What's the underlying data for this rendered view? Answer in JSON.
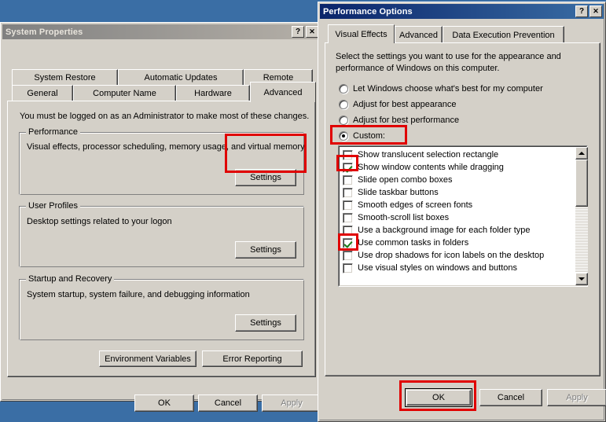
{
  "desktop": {
    "background_color": "#3a6ea5"
  },
  "system_properties": {
    "title": "System Properties",
    "titlebar_buttons": {
      "help": "?",
      "close": "✕"
    },
    "tabs_row1": [
      {
        "label": "System Restore",
        "active": false
      },
      {
        "label": "Automatic Updates",
        "active": false
      },
      {
        "label": "Remote",
        "active": false
      }
    ],
    "tabs_row2": [
      {
        "label": "General",
        "active": false
      },
      {
        "label": "Computer Name",
        "active": false
      },
      {
        "label": "Hardware",
        "active": false
      },
      {
        "label": "Advanced",
        "active": true
      }
    ],
    "notice": "You must be logged on as an Administrator to make most of these changes.",
    "groups": [
      {
        "title": "Performance",
        "description": "Visual effects, processor scheduling, memory usage, and virtual memory",
        "button": "Settings"
      },
      {
        "title": "User Profiles",
        "description": "Desktop settings related to your logon",
        "button": "Settings"
      },
      {
        "title": "Startup and Recovery",
        "description": "System startup, system failure, and debugging information",
        "button": "Settings"
      }
    ],
    "extra_buttons": [
      {
        "label": "Environment Variables"
      },
      {
        "label": "Error Reporting"
      }
    ],
    "footer_buttons": [
      {
        "label": "OK",
        "disabled": false
      },
      {
        "label": "Cancel",
        "disabled": false
      },
      {
        "label": "Apply",
        "disabled": true
      }
    ]
  },
  "performance_options": {
    "title": "Performance Options",
    "titlebar_buttons": {
      "help": "?",
      "close": "✕"
    },
    "tabs": [
      {
        "label": "Visual Effects",
        "active": true
      },
      {
        "label": "Advanced",
        "active": false
      },
      {
        "label": "Data Execution Prevention",
        "active": false
      }
    ],
    "intro_line1": "Select the settings you want to use for the appearance and",
    "intro_line2": "performance of Windows on this computer.",
    "radio_options": [
      {
        "label": "Let Windows choose what's best for my computer",
        "checked": false
      },
      {
        "label": "Adjust for best appearance",
        "checked": false
      },
      {
        "label": "Adjust for best performance",
        "checked": false
      },
      {
        "label": "Custom:",
        "checked": true
      }
    ],
    "effects_list": [
      {
        "label": "Show translucent selection rectangle",
        "checked": false
      },
      {
        "label": "Show window contents while dragging",
        "checked": true
      },
      {
        "label": "Slide open combo boxes",
        "checked": false
      },
      {
        "label": "Slide taskbar buttons",
        "checked": false
      },
      {
        "label": "Smooth edges of screen fonts",
        "checked": false
      },
      {
        "label": "Smooth-scroll list boxes",
        "checked": false
      },
      {
        "label": "Use a background image for each folder type",
        "checked": false
      },
      {
        "label": "Use common tasks in folders",
        "checked": true
      },
      {
        "label": "Use drop shadows for icon labels on the desktop",
        "checked": false
      },
      {
        "label": "Use visual styles on windows and buttons",
        "checked": false
      }
    ],
    "footer_buttons": [
      {
        "label": "OK",
        "disabled": false,
        "default": true
      },
      {
        "label": "Cancel",
        "disabled": false,
        "default": false
      },
      {
        "label": "Apply",
        "disabled": true,
        "default": false
      }
    ]
  },
  "annotations": {
    "color": "#e00000",
    "boxes": [
      {
        "name": "performance-settings-button-highlight"
      },
      {
        "name": "custom-radio-highlight"
      },
      {
        "name": "show-window-contents-checkbox-highlight"
      },
      {
        "name": "use-common-tasks-checkbox-highlight"
      },
      {
        "name": "performance-options-ok-button-highlight"
      }
    ]
  }
}
